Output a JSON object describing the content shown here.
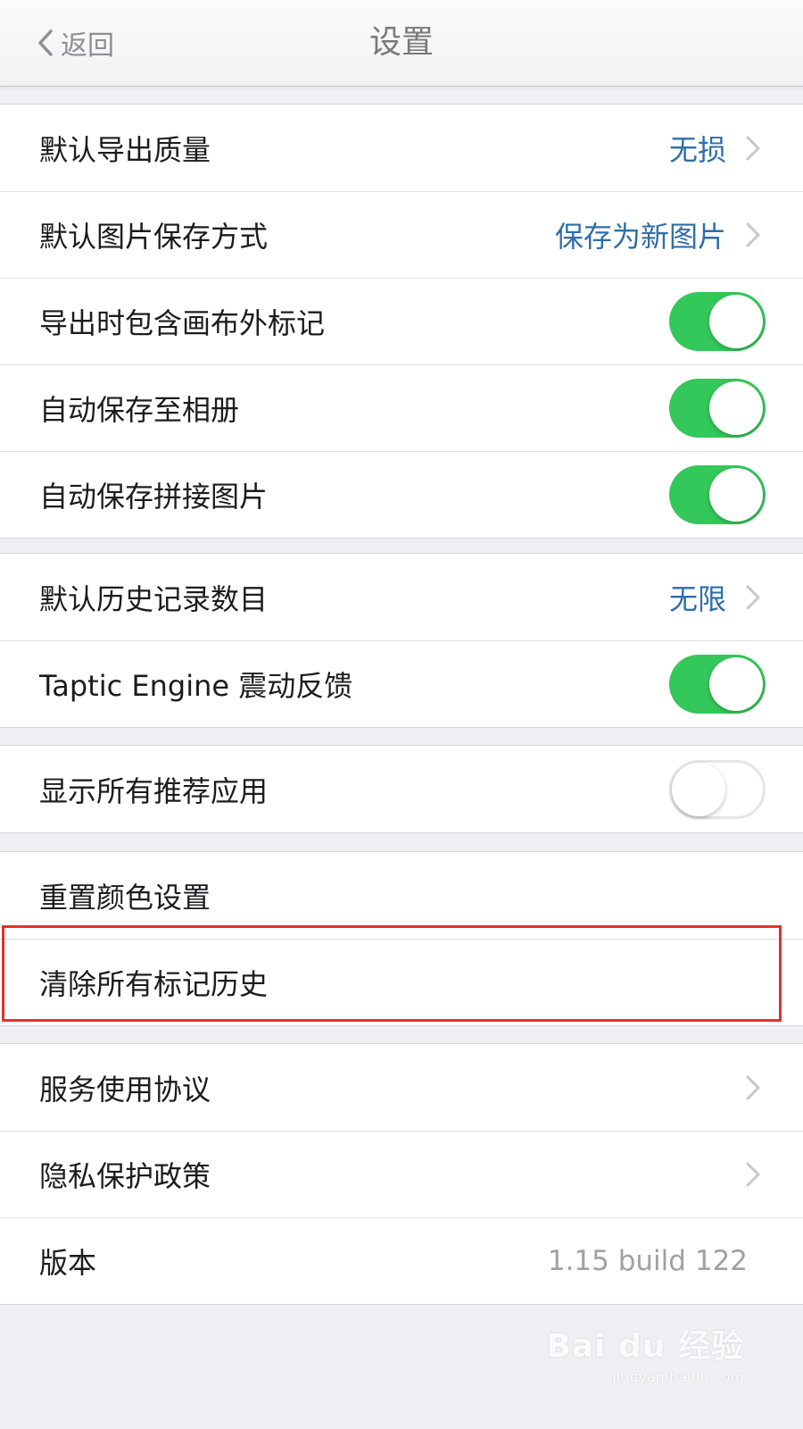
{
  "nav": {
    "back_label": "返回",
    "title": "设置"
  },
  "group1": {
    "rows": [
      {
        "label": "默认导出质量",
        "value": "无损"
      },
      {
        "label": "默认图片保存方式",
        "value": "保存为新图片"
      },
      {
        "label": "导出时包含画布外标记",
        "toggle": "on"
      },
      {
        "label": "自动保存至相册",
        "toggle": "on"
      },
      {
        "label": "自动保存拼接图片",
        "toggle": "on"
      }
    ]
  },
  "group2": {
    "rows": [
      {
        "label": "默认历史记录数目",
        "value": "无限"
      },
      {
        "label": "Taptic Engine 震动反馈",
        "toggle": "on"
      }
    ]
  },
  "group3": {
    "rows": [
      {
        "label": "显示所有推荐应用",
        "toggle": "off"
      }
    ]
  },
  "group4": {
    "rows": [
      {
        "label": "重置颜色设置"
      },
      {
        "label": "清除所有标记历史"
      }
    ]
  },
  "group5": {
    "rows": [
      {
        "label": "服务使用协议"
      },
      {
        "label": "隐私保护政策"
      },
      {
        "label": "版本",
        "value": "1.15 build 122"
      }
    ]
  },
  "colors": {
    "accent_blue": "#2f6ea8",
    "toggle_green": "#34c759",
    "highlight_red": "#e3302b",
    "background": "#efeff4"
  },
  "watermark": {
    "logo": "Bai du 经验",
    "url": "jingyan.baidu.com"
  },
  "icons": {
    "back": "chevron-left-icon",
    "disclosure": "chevron-right-icon"
  }
}
